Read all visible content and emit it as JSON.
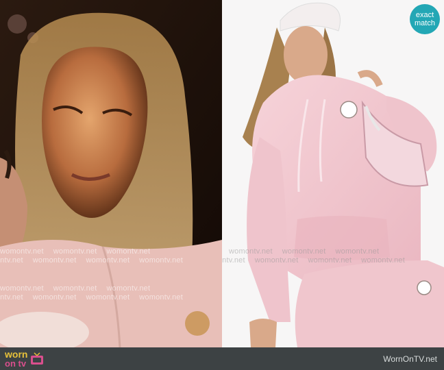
{
  "watermark_text": "womontv.net",
  "badge": {
    "line1": "exact",
    "line2": "match",
    "color": "#23a7b5"
  },
  "footer": {
    "logo_word1": "worn",
    "logo_word2": "on tv",
    "site_name": "WornOnTV.net",
    "background": "#3d4244"
  },
  "colors": {
    "hoodie_pink": "#f3c9d0",
    "scene_dark": "#1f1208"
  }
}
